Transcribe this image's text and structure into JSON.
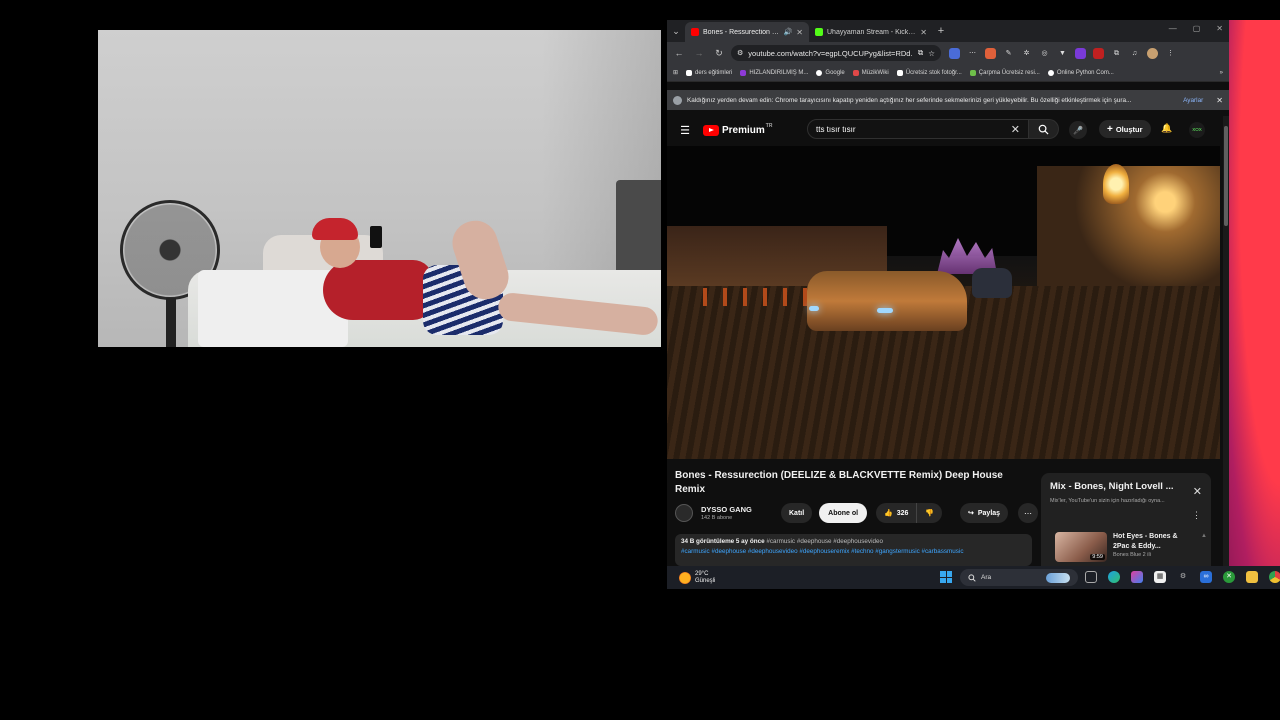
{
  "browser": {
    "tabs": [
      {
        "title": "Bones - Ressurection (DEELIZE",
        "favicon_color": "#ff0000",
        "active": true
      },
      {
        "title": "Uhayyaman Stream - Kick Dash",
        "favicon_color": "#53fc18",
        "active": false
      }
    ],
    "url": "youtube.com/watch?v=egpLQUCUPyg&list=RDd...",
    "bookmarks": [
      {
        "label": "ders eğitimleri",
        "color": "#ffffff"
      },
      {
        "label": "HIZLANDIRILMIŞ M...",
        "color": "#8e3ad8"
      },
      {
        "label": "Google",
        "color": "#ffffff"
      },
      {
        "label": "MüzikWiki",
        "color": "#e04848"
      },
      {
        "label": "Ücretsiz stok fotoğr...",
        "color": "#ffffff"
      },
      {
        "label": "Çarpma Ücretsiz resi...",
        "color": "#6fbf4a"
      },
      {
        "label": "Online Python Com...",
        "color": "#ffffff"
      }
    ],
    "infobar": {
      "message": "Kaldığınız yerden devam edin: Chrome tarayıcısını kapatıp yeniden açtığınız her seferinde sekmelerinizi geri yükleyebilir. Bu özelliği etkinleştirmek için şura...",
      "link": "Ayarlar"
    }
  },
  "youtube": {
    "logo_text": "Premium",
    "region": "TR",
    "search_query": "tts tısır tısır",
    "create_label": "Oluştur",
    "avatar_text": "XOX",
    "video": {
      "title": "Bones - Ressurection (DEELIZE & BLACKVETTE Remix) Deep House Remix",
      "channel": "DYSSO GANG",
      "subscribers": "142 B abone",
      "join_label": "Katıl",
      "subscribe_label": "Abone ol",
      "likes": "326",
      "share_label": "Paylaş",
      "views_line": "34 B görüntüleme  5 ay önce",
      "header_tags": "#carmusic #deephouse #deephousevideo",
      "description_tags": "#carmusic #deephouse #deephousevideo #deephouseremix #techno #gangstermusic #carbassmusic"
    },
    "mix": {
      "title": "Mix - Bones, Night Lovell ...",
      "subtitle": "Mix'ler, YouTube'un sizin için hazırladığı oyna...",
      "items": [
        {
          "title": "Hot Eyes - Bones & 2Pac & Eddy...",
          "duration": "9:59",
          "channel": "Bones Blue 2 ili"
        }
      ]
    }
  },
  "taskbar": {
    "temperature": "29°C",
    "weather_label": "Güneşli",
    "search_placeholder": "Ara",
    "apps": [
      "task-view",
      "edge",
      "copilot",
      "store",
      "settings",
      "visual-studio",
      "xbox",
      "file-explorer",
      "chrome"
    ]
  }
}
